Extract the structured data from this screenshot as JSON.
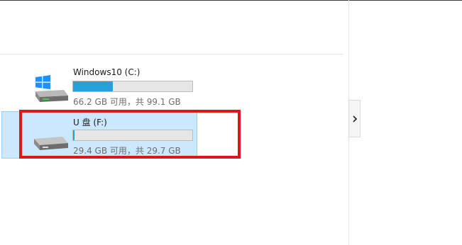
{
  "drives": [
    {
      "label": "Windows10 (C:)",
      "free_text": "66.2 GB 可用，共 99.1 GB",
      "used_fraction": 0.332,
      "icon": "windows-system-drive-icon",
      "bar_color": "#26a0da"
    },
    {
      "label": "U 盘 (F:)",
      "free_text": "29.4 GB 可用，共 29.7 GB",
      "used_fraction": 0.01,
      "icon": "usb-drive-icon",
      "bar_color": "#26a0da"
    }
  ],
  "selection": {
    "selected_drive": "U 盘 (F:)",
    "highlight_color": "#e0141c"
  },
  "preview_toggle": {
    "icon": "chevron-right-icon"
  }
}
